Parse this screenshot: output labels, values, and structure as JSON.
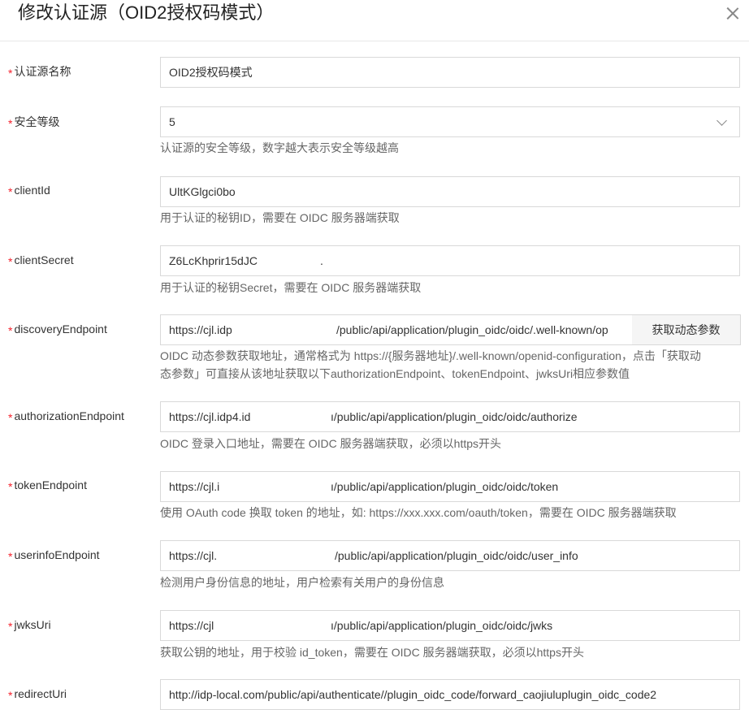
{
  "dialog": {
    "title": "修改认证源（OID2授权码模式）"
  },
  "fields": {
    "name": {
      "label": "认证源名称",
      "value": "OID2授权码模式"
    },
    "security": {
      "label": "安全等级",
      "value": "5",
      "help": "认证源的安全等级，数字越大表示安全等级越高"
    },
    "clientId": {
      "label": "clientId",
      "value": "UltKGlgci0bo",
      "help": "用于认证的秘钥ID，需要在 OIDC 服务器端获取"
    },
    "clientSecret": {
      "label": "clientSecret",
      "value": "Z6LcKhprir15dJC",
      "value_tail": ".",
      "help": "用于认证的秘钥Secret，需要在 OIDC 服务器端获取"
    },
    "discovery": {
      "label": "discoveryEndpoint",
      "value_head": "https://cjl.idp",
      "value_tail": "/public/api/application/plugin_oidc/oidc/.well-known/op",
      "button": "获取动态参数",
      "help_line1": "OIDC 动态参数获取地址，通常格式为 https://{服务器地址}/.well-known/openid-configuration，点击「获取动",
      "help_line2": "态参数」可直接从该地址获取以下authorizationEndpoint、tokenEndpoint、jwksUri相应参数值"
    },
    "authorization": {
      "label": "authorizationEndpoint",
      "value_head": "https://cjl.idp4.id",
      "value_tail": "ı/public/api/application/plugin_oidc/oidc/authorize",
      "help": "OIDC 登录入口地址，需要在 OIDC 服务器端获取，必须以https开头"
    },
    "token": {
      "label": "tokenEndpoint",
      "value_head": "https://cjl.i",
      "value_tail": "ı/public/api/application/plugin_oidc/oidc/token",
      "help": "使用 OAuth code 换取 token 的地址，如: https://xxx.xxx.com/oauth/token，需要在 OIDC 服务器端获取"
    },
    "userinfo": {
      "label": "userinfoEndpoint",
      "value_head": "https://cjl.",
      "value_tail": "/public/api/application/plugin_oidc/oidc/user_info",
      "help": "检测用户身份信息的地址，用户检索有关用户的身份信息"
    },
    "jwks": {
      "label": "jwksUri",
      "value_head": "https://cjl",
      "value_tail": "ı/public/api/application/plugin_oidc/oidc/jwks",
      "help": "获取公钥的地址，用于校验 id_token，需要在 OIDC 服务器端获取，必须以https开头"
    },
    "redirect": {
      "label": "redirectUri",
      "value": "http://idp-local.com/public/api/authenticate//plugin_oidc_code/forward_caojiuluplugin_oidc_code2"
    }
  },
  "required_mark": "*"
}
